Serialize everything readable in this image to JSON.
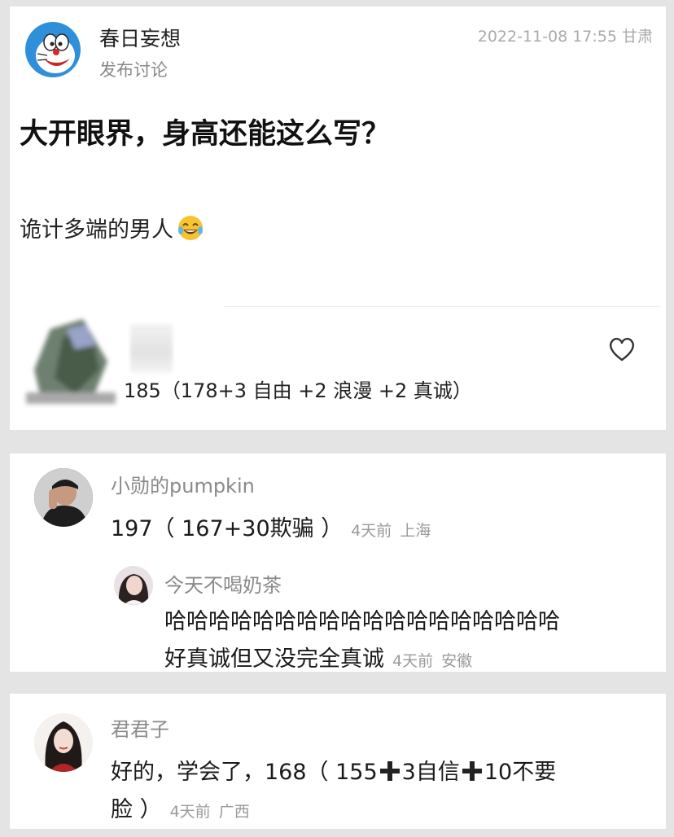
{
  "post": {
    "author": "春日妄想",
    "action": "发布讨论",
    "time_location": "2022-11-08 17:55 甘肃",
    "title": "大开眼界，身高还能这么写？",
    "body": "诡计多端的男人",
    "emoji": "laughing-crying-emoji",
    "caption": "185（178+3 自由 +2 浪漫 +2 真诚）",
    "like_icon": "heart-icon"
  },
  "comments": [
    {
      "author": "小勋的pumpkin",
      "text": "197（ 167+30欺骗 ）",
      "time": "4天前",
      "location": "上海",
      "reply": {
        "author": "今天不喝奶茶",
        "text_line1": "哈哈哈哈哈哈哈哈哈哈哈哈哈哈哈哈哈哈",
        "text_line2": "好真诚但又没完全真诚",
        "time": "4天前",
        "location": "安徽"
      }
    },
    {
      "author": "君君子",
      "text_a": "好的，学会了，168（ 155",
      "text_b": "3自信",
      "text_c": "10不要",
      "text_line2": "脸 ）",
      "time": "4天前",
      "location": "广西"
    }
  ],
  "colors": {
    "background": "#e4e4e4",
    "card": "#ffffff",
    "name_gray": "#8a8a8a",
    "meta_gray": "#9a9a9a"
  }
}
